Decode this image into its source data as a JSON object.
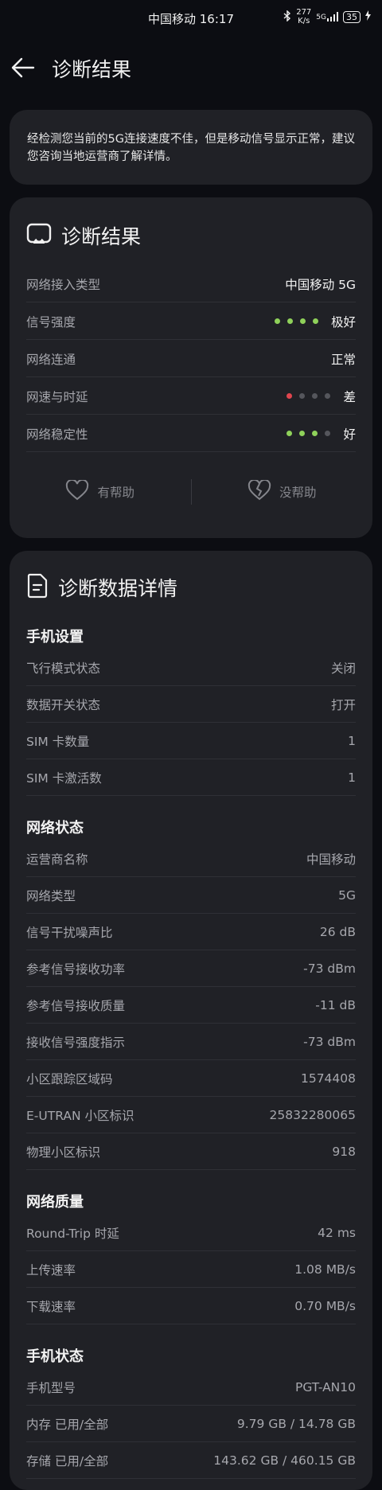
{
  "status_bar": {
    "carrier_time": "中国移动 16:17",
    "net_speed_value": "277",
    "net_speed_unit": "K/s",
    "signal": "5G",
    "battery": "35"
  },
  "header": {
    "title": "诊断结果"
  },
  "notice": {
    "text": "经检测您当前的5G连接速度不佳，但是移动信号显示正常，建议您咨询当地运营商了解详情。"
  },
  "result": {
    "title": "诊断结果",
    "rows": [
      {
        "label": "网络接入类型",
        "value": "中国移动 5G"
      },
      {
        "label": "信号强度",
        "value": "极好"
      },
      {
        "label": "网络连通",
        "value": "正常"
      },
      {
        "label": "网速与时延",
        "value": "差"
      },
      {
        "label": "网络稳定性",
        "value": "好"
      }
    ],
    "helpful": "有帮助",
    "not_helpful": "没帮助"
  },
  "details": {
    "title": "诊断数据详情",
    "sections": [
      {
        "title": "手机设置",
        "rows": [
          {
            "label": "飞行模式状态",
            "value": "关闭"
          },
          {
            "label": "数据开关状态",
            "value": "打开"
          },
          {
            "label": "SIM 卡数量",
            "value": "1"
          },
          {
            "label": "SIM 卡激活数",
            "value": "1"
          }
        ]
      },
      {
        "title": "网络状态",
        "rows": [
          {
            "label": "运营商名称",
            "value": "中国移动"
          },
          {
            "label": "网络类型",
            "value": "5G"
          },
          {
            "label": "信号干扰噪声比",
            "value": "26 dB"
          },
          {
            "label": "参考信号接收功率",
            "value": "-73 dBm"
          },
          {
            "label": "参考信号接收质量",
            "value": "-11 dB"
          },
          {
            "label": "接收信号强度指示",
            "value": "-73 dBm"
          },
          {
            "label": "小区跟踪区域码",
            "value": "1574408"
          },
          {
            "label": "E-UTRAN 小区标识",
            "value": "25832280065"
          },
          {
            "label": "物理小区标识",
            "value": "918"
          }
        ]
      },
      {
        "title": "网络质量",
        "rows": [
          {
            "label": "Round-Trip 时延",
            "value": "42 ms"
          },
          {
            "label": "上传速率",
            "value": "1.08 MB/s"
          },
          {
            "label": "下载速率",
            "value": "0.70 MB/s"
          }
        ]
      },
      {
        "title": "手机状态",
        "rows": [
          {
            "label": "手机型号",
            "value": "PGT-AN10"
          },
          {
            "label": "内存 已用/全部",
            "value": "9.79 GB / 14.78 GB"
          },
          {
            "label": "存储 已用/全部",
            "value": "143.62 GB / 460.15 GB"
          }
        ]
      }
    ]
  },
  "colors": {
    "good": "#8fd15a",
    "bad": "#e0454e",
    "inactive": "#55565c"
  }
}
